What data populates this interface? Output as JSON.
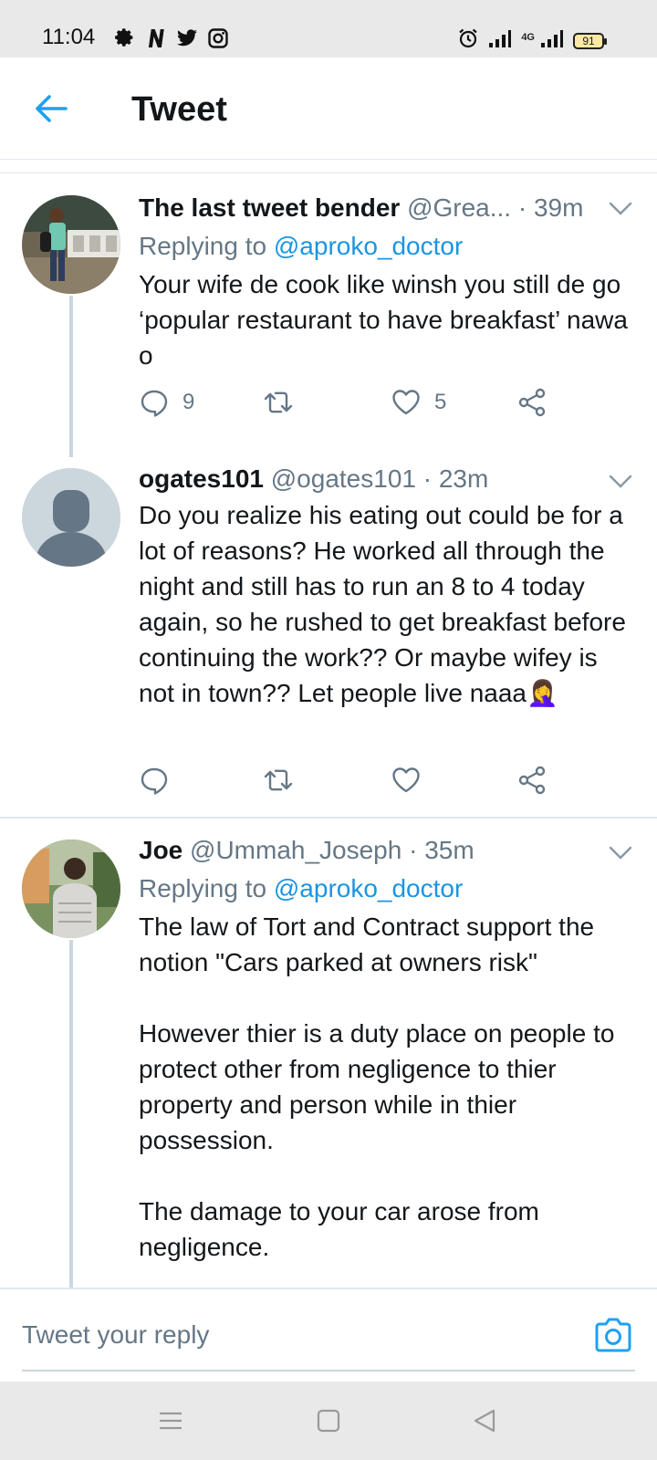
{
  "status_bar": {
    "time": "11:04",
    "battery": "91",
    "network_label": "4G",
    "left_icons": [
      "gear-icon",
      "netflix-icon",
      "twitter-icon",
      "instagram-icon"
    ],
    "right_icons": [
      "alarm-icon",
      "signal-icon",
      "signal-4g-icon",
      "battery-icon"
    ]
  },
  "header": {
    "title": "Tweet"
  },
  "tweets": [
    {
      "name": "The last tweet bender",
      "handle": "@Grea...",
      "separator": "·",
      "time": "39m",
      "reply_prefix": "Replying to",
      "reply_mention": "@aproko_doctor",
      "text": "Your wife de cook like winsh you still de go ‘popular restaurant to have breakfast’ nawa o",
      "reply_count": "9",
      "retweet_count": "",
      "like_count": "5"
    },
    {
      "name": "ogates101",
      "handle": "@ogates101",
      "separator": "·",
      "time": "23m",
      "text": "Do you realize his eating out could be for a lot of reasons? He worked all through the night and still has to run an 8 to 4 today again, so he rushed to get breakfast before continuing the work?? Or maybe wifey is not in town?? Let people live naaa🤦‍♀️",
      "reply_count": "",
      "retweet_count": "",
      "like_count": ""
    },
    {
      "name": "Joe",
      "handle": "@Ummah_Joseph",
      "separator": "·",
      "time": "35m",
      "reply_prefix": "Replying to",
      "reply_mention": "@aproko_doctor",
      "text": "The law of Tort and Contract support the notion \"Cars parked at owners risk\"\n\nHowever thier is a duty place on people to protect other from negligence to thier property and person while in thier possession.\n\nThe damage to your car arose from negligence."
    }
  ],
  "reply_bar": {
    "placeholder": "Tweet your reply"
  },
  "colors": {
    "accent": "#1da1f2",
    "mention": "#1b95e0",
    "secondary_text": "#657786",
    "divider": "#e1e8ed"
  }
}
